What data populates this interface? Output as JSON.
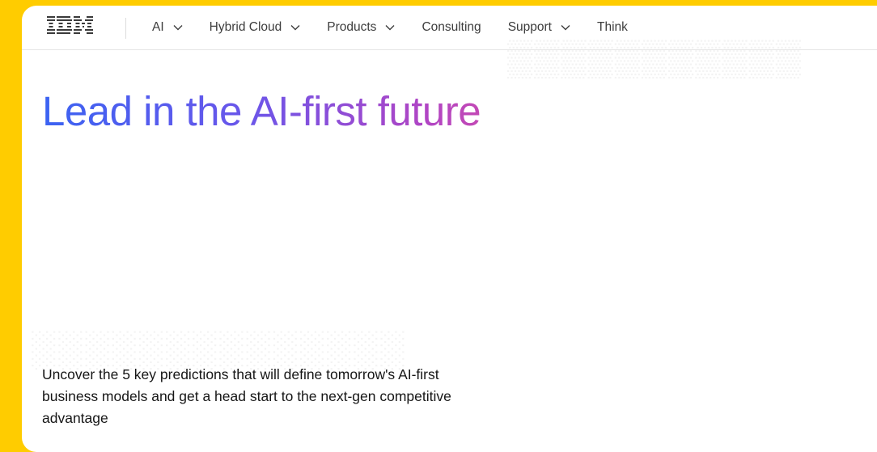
{
  "brand": {
    "logo_text": "IBM",
    "colors": {
      "background_frame": "#ffcc00",
      "page": "#ffffff",
      "headline_gradient_start": "#3b63f2",
      "headline_gradient_end": "#c84ab1",
      "nav_text": "#3d3d3d"
    }
  },
  "nav": {
    "items": [
      {
        "label": "AI",
        "has_dropdown": true,
        "icon": "chevron-down-icon"
      },
      {
        "label": "Hybrid Cloud",
        "has_dropdown": true,
        "icon": "chevron-down-icon"
      },
      {
        "label": "Products",
        "has_dropdown": true,
        "icon": "chevron-down-icon"
      },
      {
        "label": "Consulting",
        "has_dropdown": false
      },
      {
        "label": "Support",
        "has_dropdown": true,
        "icon": "chevron-down-icon"
      },
      {
        "label": "Think",
        "has_dropdown": false
      }
    ]
  },
  "hero": {
    "title": "Lead in the AI-first future",
    "subtitle": "Uncover the 5 key predictions that will define tomorrow's AI-first business models and get a head start to the next-gen competitive advantage"
  }
}
